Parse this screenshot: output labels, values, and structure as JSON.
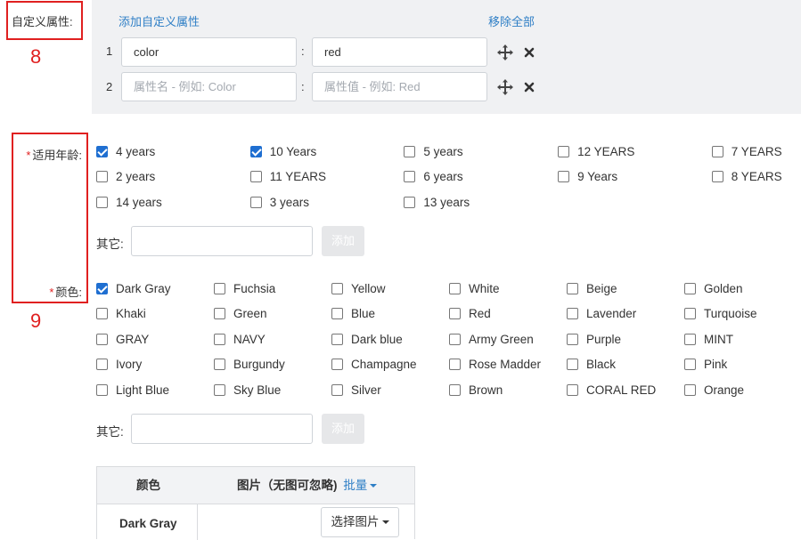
{
  "custom_attrs": {
    "label": "自定义属性:",
    "add_link": "添加自定义属性",
    "remove_all_link": "移除全部",
    "rows": [
      {
        "index": "1",
        "name_value": "color",
        "name_placeholder": "",
        "value_value": "red",
        "value_placeholder": ""
      },
      {
        "index": "2",
        "name_value": "",
        "name_placeholder": "属性名 - 例如: Color",
        "value_value": "",
        "value_placeholder": "属性值 - 例如: Red"
      }
    ],
    "colon": ":",
    "move_icon": "move-arrows-icon",
    "delete_icon": "close-x-icon"
  },
  "annotations": {
    "box8_number": "8",
    "box9_number": "9"
  },
  "age": {
    "required_mark": "*",
    "label": "适用年龄:",
    "options": [
      {
        "label": "4 years",
        "checked": true
      },
      {
        "label": "10 Years",
        "checked": true
      },
      {
        "label": "5 years",
        "checked": false
      },
      {
        "label": "12 YEARS",
        "checked": false
      },
      {
        "label": "7 YEARS",
        "checked": false
      },
      {
        "label": "2 years",
        "checked": false
      },
      {
        "label": "11 YEARS",
        "checked": false
      },
      {
        "label": "6 years",
        "checked": false
      },
      {
        "label": "9 Years",
        "checked": false
      },
      {
        "label": "8 YEARS",
        "checked": false
      },
      {
        "label": "14 years",
        "checked": false
      },
      {
        "label": "3 years",
        "checked": false
      },
      {
        "label": "13 years",
        "checked": false
      }
    ],
    "other_label": "其它:",
    "other_value": "",
    "add_button": "添加"
  },
  "color": {
    "required_mark": "*",
    "label": "颜色:",
    "options": [
      {
        "label": "Dark Gray",
        "checked": true
      },
      {
        "label": "Fuchsia",
        "checked": false
      },
      {
        "label": "Yellow",
        "checked": false
      },
      {
        "label": "White",
        "checked": false
      },
      {
        "label": "Beige",
        "checked": false
      },
      {
        "label": "Golden",
        "checked": false
      },
      {
        "label": "Khaki",
        "checked": false
      },
      {
        "label": "Green",
        "checked": false
      },
      {
        "label": "Blue",
        "checked": false
      },
      {
        "label": "Red",
        "checked": false
      },
      {
        "label": "Lavender",
        "checked": false
      },
      {
        "label": "Turquoise",
        "checked": false
      },
      {
        "label": "GRAY",
        "checked": false
      },
      {
        "label": "NAVY",
        "checked": false
      },
      {
        "label": "Dark blue",
        "checked": false
      },
      {
        "label": "Army Green",
        "checked": false
      },
      {
        "label": "Purple",
        "checked": false
      },
      {
        "label": "MINT",
        "checked": false
      },
      {
        "label": "Ivory",
        "checked": false
      },
      {
        "label": "Burgundy",
        "checked": false
      },
      {
        "label": "Champagne",
        "checked": false
      },
      {
        "label": "Rose Madder",
        "checked": false
      },
      {
        "label": "Black",
        "checked": false
      },
      {
        "label": "Pink",
        "checked": false
      },
      {
        "label": "Light Blue",
        "checked": false
      },
      {
        "label": "Sky Blue",
        "checked": false
      },
      {
        "label": "Silver",
        "checked": false
      },
      {
        "label": "Brown",
        "checked": false
      },
      {
        "label": "CORAL RED",
        "checked": false
      },
      {
        "label": "Orange",
        "checked": false
      }
    ],
    "other_label": "其它:",
    "other_value": "",
    "add_button": "添加"
  },
  "image_table": {
    "col_color": "颜色",
    "col_image": "图片（无图可忽略)",
    "batch_link": "批量",
    "rows": [
      {
        "color": "Dark Gray",
        "pick_button": "选择图片"
      }
    ]
  },
  "colors": {
    "accent": "#1f6fd1",
    "link": "#2f7fc6",
    "annotation_red": "#e02020",
    "panel_bg": "#f0f1f3"
  }
}
